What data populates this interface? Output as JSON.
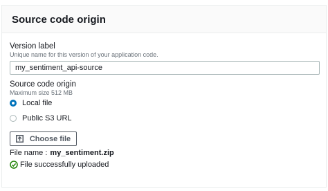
{
  "panel": {
    "title": "Source code origin"
  },
  "version": {
    "label": "Version label",
    "description": "Unique name for this version of your application code.",
    "value": "my_sentiment_api-source"
  },
  "origin": {
    "label": "Source code origin",
    "description": "Maximum size 512 MB",
    "options": [
      {
        "label": "Local file",
        "selected": true
      },
      {
        "label": "Public S3 URL",
        "selected": false
      }
    ]
  },
  "upload": {
    "button_label": "Choose file",
    "file_name_label": "File name :",
    "file_name": "my_sentiment.zip",
    "status_text": "File successfully uploaded"
  },
  "icons": {
    "upload": "upload-icon",
    "success": "check-circle-icon"
  },
  "colors": {
    "accent": "#0073bb",
    "success": "#1d8102",
    "border": "#aab7b8"
  }
}
